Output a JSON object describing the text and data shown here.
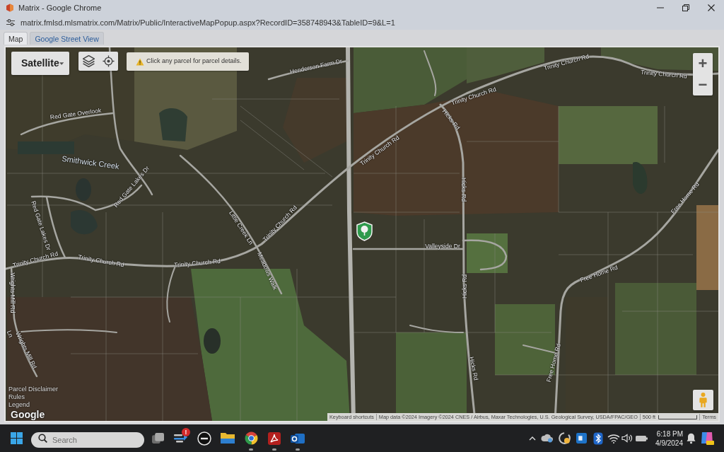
{
  "window": {
    "title": "Matrix - Google Chrome"
  },
  "address_bar": {
    "url": "matrix.fmlsd.mlsmatrix.com/Matrix/Public/InteractiveMapPopup.aspx?RecordID=358748943&TableID=9&L=1"
  },
  "tabs": [
    {
      "label": "Map",
      "selected": true
    },
    {
      "label": "Google Street View",
      "selected": false
    }
  ],
  "map": {
    "map_type": "Satellite",
    "notice": "Click any parcel for parcel details.",
    "zoom_buttons": [
      {
        "label": "+"
      },
      {
        "label": "−"
      }
    ],
    "labels": [
      {
        "text": "Henderson Farm Dr",
        "kind": "road"
      },
      {
        "text": "Trinity Church Rd",
        "kind": "road"
      },
      {
        "text": "Trinity Church Rd",
        "kind": "road"
      },
      {
        "text": "Trinity Church Rd",
        "kind": "road"
      },
      {
        "text": "Red Gate Overlook",
        "kind": "road"
      },
      {
        "text": "Hicks Rd",
        "kind": "road"
      },
      {
        "text": "Trinity Church Rd",
        "kind": "road"
      },
      {
        "text": "Smithwick Creek",
        "kind": "water"
      },
      {
        "text": "Red Gate Lakes Dr",
        "kind": "road"
      },
      {
        "text": "Hicks Rd",
        "kind": "road"
      },
      {
        "text": "Free Home Rd",
        "kind": "road"
      },
      {
        "text": "Trinity Church Rd",
        "kind": "road"
      },
      {
        "text": "Red Gate Lakes Dr",
        "kind": "road"
      },
      {
        "text": "Little Creek Ln",
        "kind": "road"
      },
      {
        "text": "Valleyside Dr",
        "kind": "road"
      },
      {
        "text": "Trinity Church Rd",
        "kind": "road"
      },
      {
        "text": "Trinity Church Rd",
        "kind": "road"
      },
      {
        "text": "Trinity Church Rd",
        "kind": "road"
      },
      {
        "text": "Meadows Walk",
        "kind": "road"
      },
      {
        "text": "Free Home Rd",
        "kind": "road"
      },
      {
        "text": "Hicks Rd",
        "kind": "road"
      },
      {
        "text": "Wrights Mill Rd",
        "kind": "road"
      },
      {
        "text": "Ln",
        "kind": "road"
      },
      {
        "text": "Wrights Mill Rd",
        "kind": "road"
      },
      {
        "text": "Free Home Rd",
        "kind": "road"
      },
      {
        "text": "Hicks Rd",
        "kind": "road"
      }
    ],
    "links": [
      "Parcel Disclaimer",
      "Rules",
      "Legend"
    ],
    "logo": "Google",
    "attribution": {
      "shortcuts": "Keyboard shortcuts",
      "data": "Map data ©2024 Imagery ©2024 CNES / Airbus, Maxar Technologies, U.S. Geological Survey, USDA/FPAC/GEO",
      "scale": "500 ft",
      "terms": "Terms"
    }
  },
  "taskbar": {
    "search": {
      "placeholder": "Search"
    },
    "apps": [
      {
        "kind": "taskview",
        "running": false
      },
      {
        "kind": "feedback",
        "running": false,
        "badge": "!"
      },
      {
        "kind": "circlelogo",
        "running": false
      },
      {
        "kind": "files",
        "running": false
      },
      {
        "kind": "browser",
        "running": true
      },
      {
        "kind": "pdf",
        "running": true
      },
      {
        "kind": "mail",
        "running": true
      }
    ],
    "clock": {
      "time": "6:18 PM",
      "date": "4/9/2024"
    }
  }
}
